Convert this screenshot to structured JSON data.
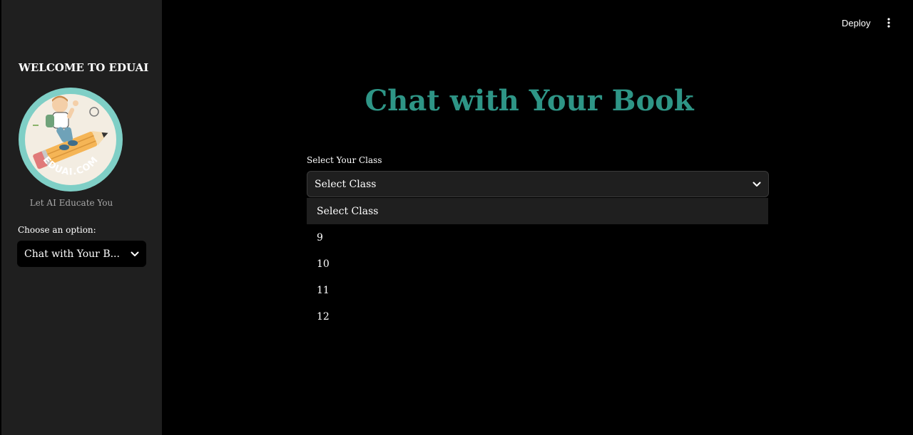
{
  "header": {
    "deploy_label": "Deploy",
    "menu_icon": "kebab-menu-icon"
  },
  "sidebar": {
    "title": "WELCOME TO EDUAI",
    "logo_text": "EDUAI.COM",
    "tagline": "Let AI Educate You",
    "choose_label": "Choose an option:",
    "selected_option": "Chat with Your B...",
    "chevron_icon": "chevron-down-icon"
  },
  "main": {
    "title": "Chat with Your Book",
    "class_select": {
      "label": "Select Your Class",
      "value": "Select Class",
      "options": [
        "Select Class",
        "9",
        "10",
        "11",
        "12"
      ],
      "highlighted_index": 0
    }
  },
  "colors": {
    "background": "#000000",
    "sidebar_background": "#1f1f1f",
    "title_accent": "#2e9586",
    "select_background": "#1f1f1f",
    "logo_ring": "#7fcfc6"
  }
}
